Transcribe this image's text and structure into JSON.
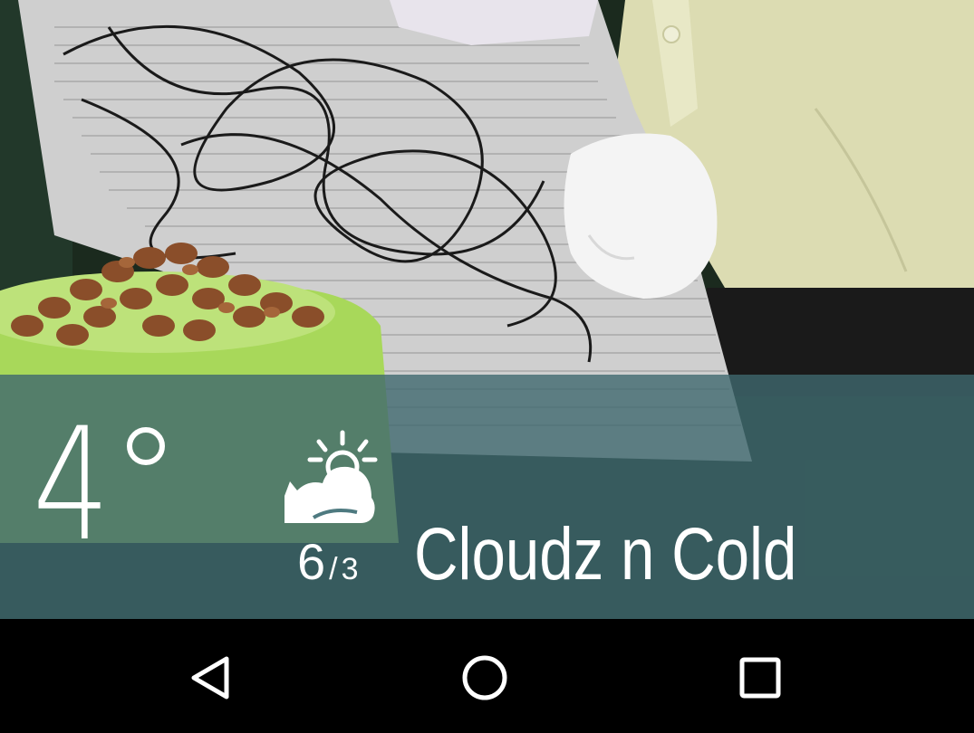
{
  "weather": {
    "temperature": "4",
    "high": "6",
    "separator": "/",
    "low": "3",
    "condition": "Cloudz n Cold",
    "condition_icon": "partly-cloudy-cat-icon",
    "panel_color": "#3e686e"
  },
  "navbar": {
    "back_icon": "back-triangle-icon",
    "home_icon": "home-circle-icon",
    "recents_icon": "recents-square-icon"
  },
  "background": {
    "description_colors": {
      "food_bowl": "#a8d85a",
      "jacket": "#dcdcb0",
      "newspaper": "#c8c8c8"
    }
  }
}
